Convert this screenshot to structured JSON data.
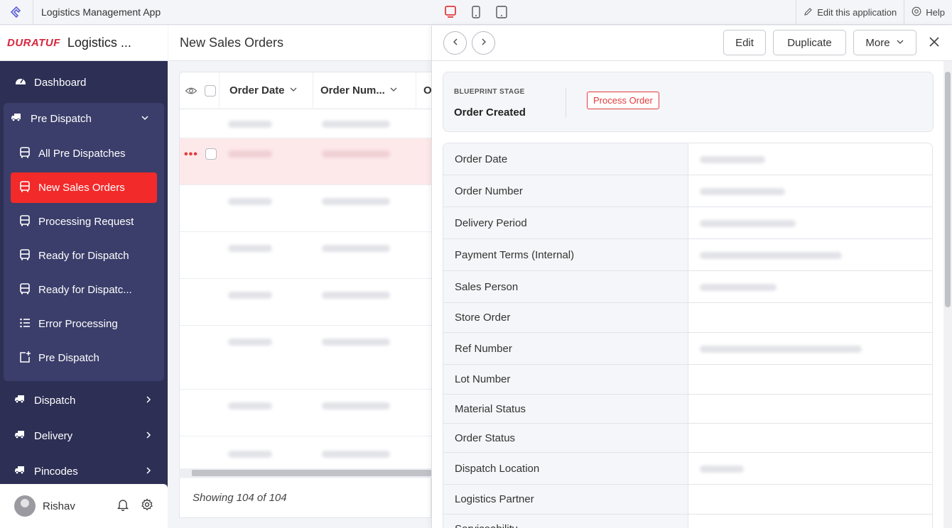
{
  "app": {
    "title": "Logistics Management App"
  },
  "topbar": {
    "edit_label": "Edit this application",
    "help_label": "Help"
  },
  "brand": {
    "logo_text": "DURATUF",
    "name": "Logistics ..."
  },
  "sidebar": {
    "dashboard": "Dashboard",
    "group_label": "Pre Dispatch",
    "sub_items": [
      "All Pre Dispatches",
      "New Sales Orders",
      "Processing Request",
      "Ready for Dispatch",
      "Ready for Dispatc...",
      "Error Processing",
      "Pre Dispatch"
    ],
    "active_item": "New Sales Orders",
    "dispatch": "Dispatch",
    "delivery": "Delivery",
    "pincodes": "Pincodes"
  },
  "user": {
    "name": "Rishav"
  },
  "list": {
    "title": "New Sales Orders",
    "columns": [
      "Order Date",
      "Order Num...",
      "O"
    ],
    "footer": "Showing 104 of 104"
  },
  "panel": {
    "buttons": {
      "edit": "Edit",
      "duplicate": "Duplicate",
      "more": "More"
    },
    "stage": {
      "label": "BLUEPRINT STAGE",
      "value": "Order Created",
      "action": "Process Order"
    },
    "fields": [
      "Order Date",
      "Order Number",
      "Delivery Period",
      "Payment Terms (Internal)",
      "Sales Person",
      "Store Order",
      "Ref Number",
      "Lot Number",
      "Material Status",
      "Order Status",
      "Dispatch Location",
      "Logistics Partner",
      "Serviceability"
    ]
  },
  "colors": {
    "sidebar": "#2d2f55",
    "accent": "#f22a2a"
  }
}
